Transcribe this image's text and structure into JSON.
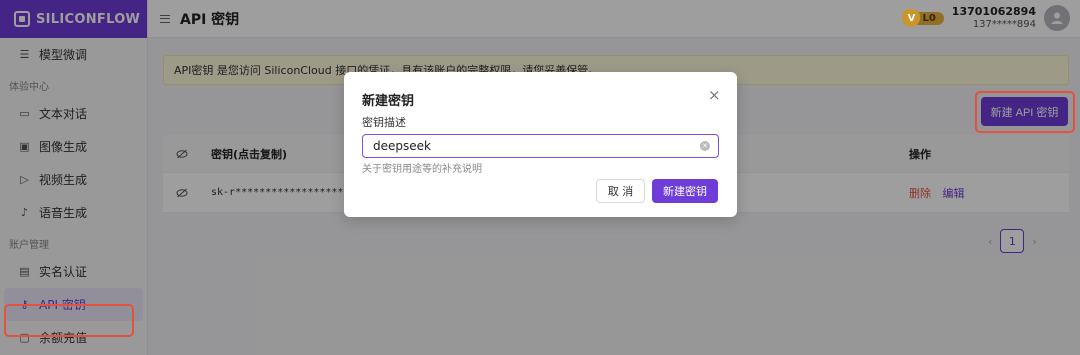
{
  "brand": {
    "logo_text": "SILICONFLOW"
  },
  "topbar": {
    "title": "API 密钥",
    "level": "L0",
    "user_phone": "13701062894",
    "user_masked": "137*****894"
  },
  "sidebar": {
    "items": [
      {
        "label": "模型微调",
        "icon": "sliders-icon"
      },
      {
        "section": "体验中心"
      },
      {
        "label": "文本对话",
        "icon": "chat-icon"
      },
      {
        "label": "图像生成",
        "icon": "image-icon"
      },
      {
        "label": "视频生成",
        "icon": "video-icon"
      },
      {
        "label": "语音生成",
        "icon": "mic-icon"
      },
      {
        "section": "账户管理"
      },
      {
        "label": "实名认证",
        "icon": "id-card-icon"
      },
      {
        "label": "API 密钥",
        "icon": "key-icon",
        "active": true
      },
      {
        "label": "余额充值",
        "icon": "wallet-icon"
      }
    ]
  },
  "main": {
    "notice": "API密钥 是您访问 SiliconCloud 接口的凭证，具有该账户的完整权限，请您妥善保管。",
    "new_key_button": "新建 API 密钥",
    "table": {
      "headers": {
        "key": "密钥(点击复制)",
        "ops": "操作"
      },
      "rows": [
        {
          "key": "sk-r****************************",
          "delete": "删除",
          "edit": "编辑"
        }
      ]
    },
    "pagination": {
      "current": "1",
      "prev": "‹",
      "next": "›"
    }
  },
  "modal": {
    "title": "新建密钥",
    "close": "×",
    "field_label": "密钥描述",
    "field_value": "deepseek",
    "field_hint": "关于密钥用途等的补充说明",
    "cancel": "取 消",
    "confirm": "新建密钥"
  },
  "colors": {
    "accent": "#6e3cd7",
    "danger": "#e2533f",
    "highlight_box": "#e2533f"
  }
}
